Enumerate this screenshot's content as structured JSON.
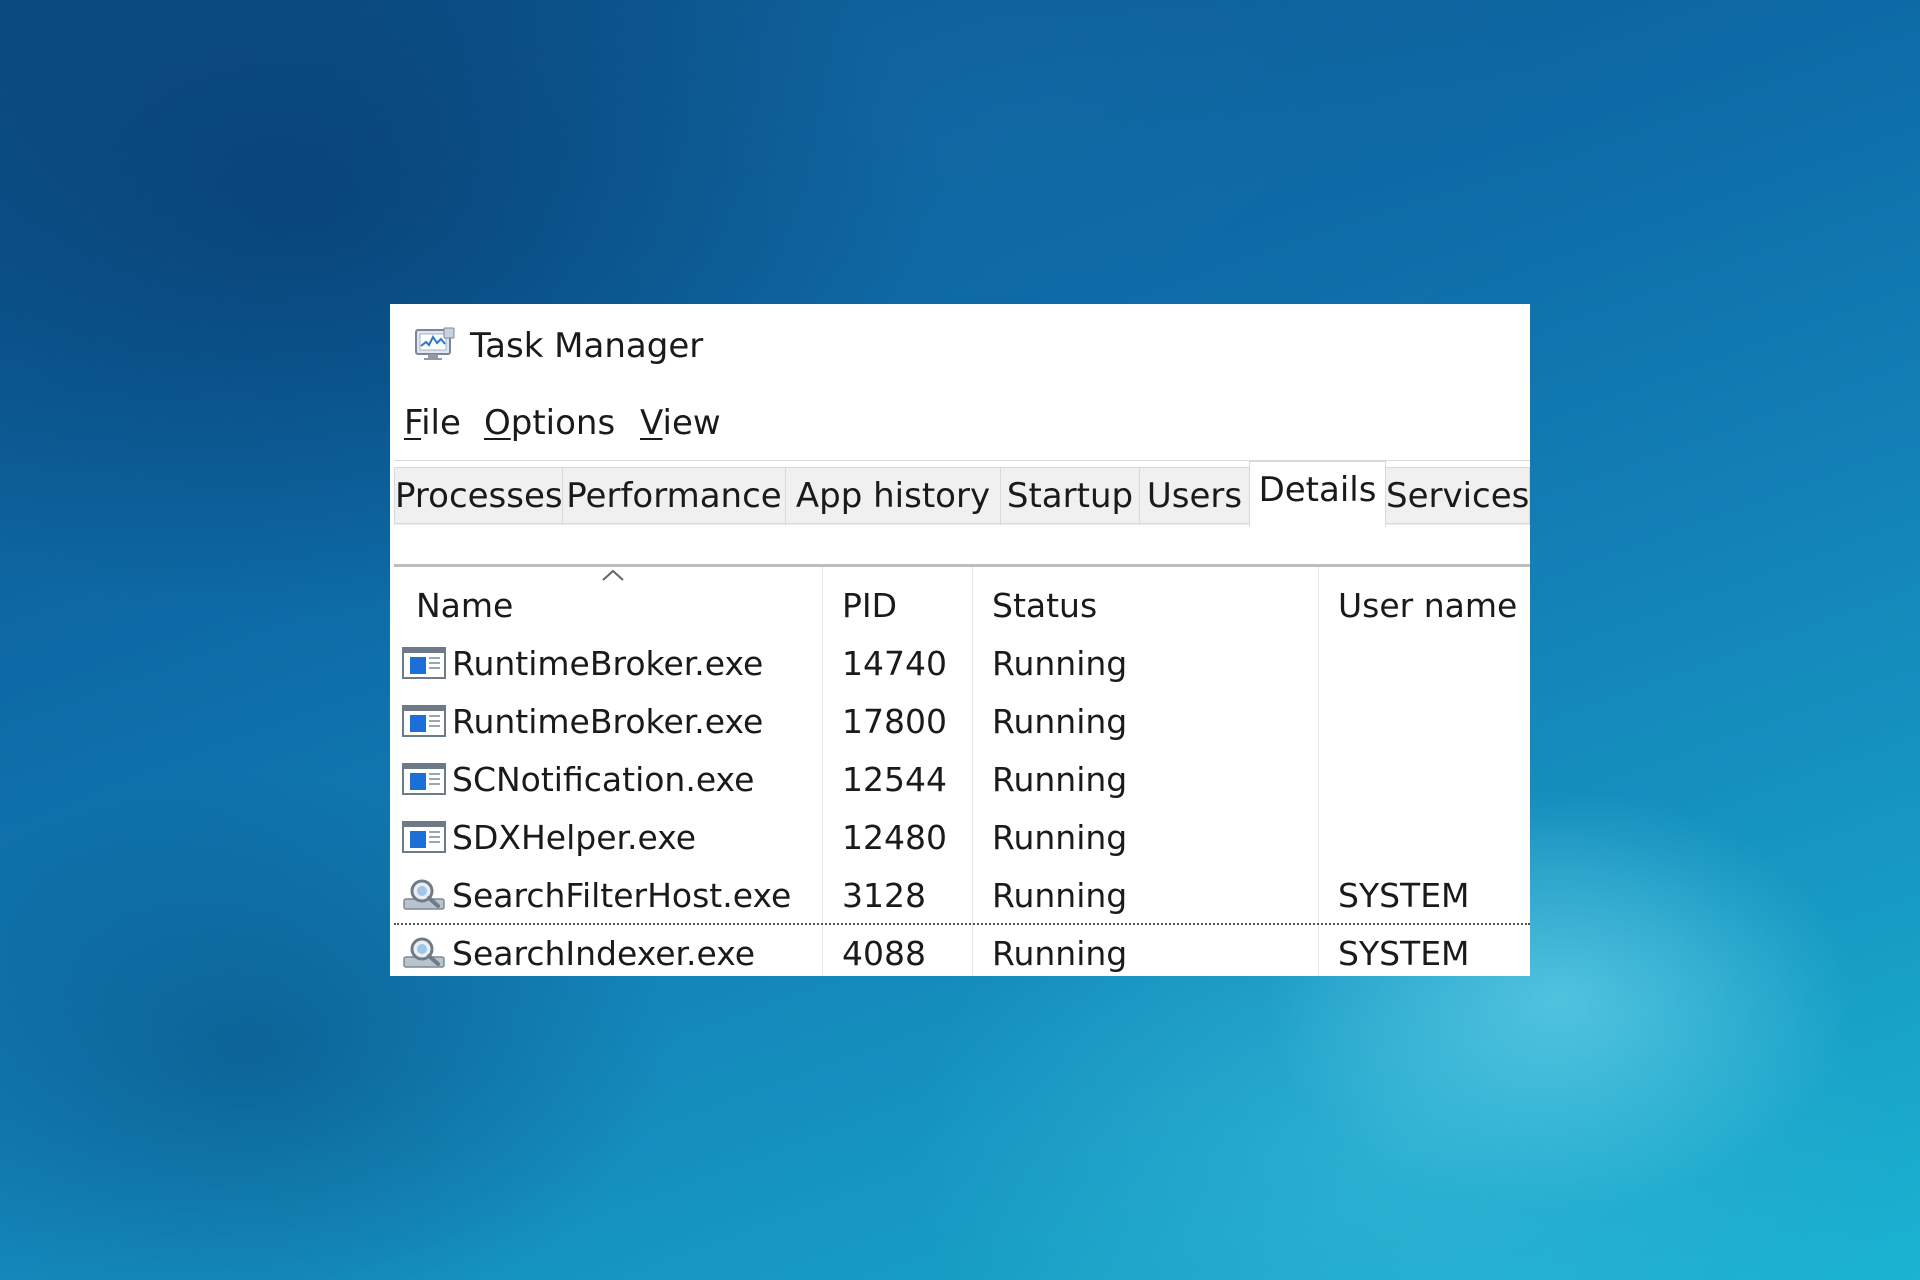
{
  "window": {
    "title": "Task Manager",
    "icon": "task-manager-icon"
  },
  "menu": {
    "items": [
      {
        "label_first": "F",
        "label_rest": "ile"
      },
      {
        "label_first": "O",
        "label_rest": "ptions"
      },
      {
        "label_first": "V",
        "label_rest": "iew"
      }
    ]
  },
  "tabs": [
    {
      "label": "Processes"
    },
    {
      "label": "Performance"
    },
    {
      "label": "App history"
    },
    {
      "label": "Startup"
    },
    {
      "label": "Users"
    },
    {
      "label": "Details",
      "active": true
    },
    {
      "label": "Services"
    }
  ],
  "table": {
    "sorted_column": "Name",
    "columns": [
      "Name",
      "PID",
      "Status",
      "User name"
    ],
    "rows": [
      {
        "name": "RuntimeBroker.exe",
        "pid": "14740",
        "status": "Running",
        "user": "",
        "icon": "app-window-icon"
      },
      {
        "name": "RuntimeBroker.exe",
        "pid": "17800",
        "status": "Running",
        "user": "",
        "icon": "app-window-icon"
      },
      {
        "name": "SCNotification.exe",
        "pid": "12544",
        "status": "Running",
        "user": "",
        "icon": "app-window-icon"
      },
      {
        "name": "SDXHelper.exe",
        "pid": "12480",
        "status": "Running",
        "user": "",
        "icon": "app-window-icon"
      },
      {
        "name": "SearchFilterHost.exe",
        "pid": "3128",
        "status": "Running",
        "user": "SYSTEM",
        "icon": "search-service-icon"
      },
      {
        "name": "SearchIndexer.exe",
        "pid": "4088",
        "status": "Running",
        "user": "SYSTEM",
        "icon": "search-service-icon"
      }
    ]
  },
  "colors": {
    "window_bg": "#ffffff",
    "tab_bg": "#f0f0f0",
    "text": "#1a1a1a"
  }
}
